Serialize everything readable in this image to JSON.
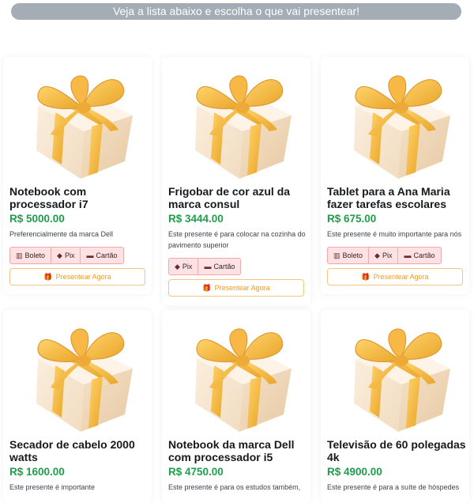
{
  "banner": "Veja a lista abaixo e escolha o que vai presentear!",
  "labels": {
    "boleto": "Boleto",
    "pix": "Pix",
    "cartao": "Cartão",
    "give": "Presentear Agora"
  },
  "gifts": [
    {
      "name": "Notebook com processador i7",
      "price": "R$ 5000.00",
      "desc": "Preferencialmente da marca Dell"
    },
    {
      "name": "Frigobar de cor azul da marca consul",
      "price": "R$ 3444.00",
      "desc": "Este presente é para colocar na cozinha do pavimento superior"
    },
    {
      "name": "Tablet para a Ana Maria fazer tarefas escolares",
      "price": "R$ 675.00",
      "desc": "Este presente é muito importante para nós"
    },
    {
      "name": "Secador de cabelo 2000 watts",
      "price": "R$ 1600.00",
      "desc": "Este presente é importante"
    },
    {
      "name": "Notebook da marca Dell com processador i5",
      "price": "R$ 4750.00",
      "desc": "Este presente é para os estudos também,"
    },
    {
      "name": "Televisão de 60 polegadas 4k",
      "price": "R$ 4900.00",
      "desc": "Este presente é para a suíte de hóspedes"
    }
  ]
}
